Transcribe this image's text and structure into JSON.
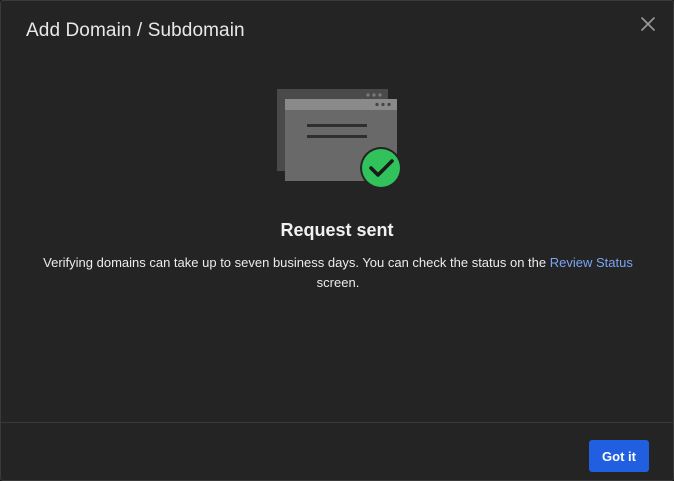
{
  "dialog": {
    "title": "Add Domain / Subdomain",
    "close_icon": "close-icon"
  },
  "illustration": {
    "icon": "browser-windows-check-icon",
    "check_color": "#31c25b"
  },
  "status": {
    "heading": "Request sent",
    "message_before": "Verifying domains can take up to seven business days. You can check the status on the ",
    "link_text": "Review Status",
    "message_after": " screen."
  },
  "footer": {
    "primary_label": "Got it",
    "primary_color": "#1f5fe0"
  }
}
